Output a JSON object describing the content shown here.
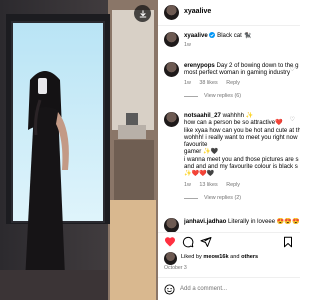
{
  "post": {
    "username": "xyaalive",
    "caption_user": "xyaalive",
    "caption_text": "Black cat 🐈‍⬛",
    "caption_time": "1w"
  },
  "comments": [
    {
      "username": "erenypops",
      "line1": "Day 2 of bowing down to the g",
      "line2": "most perfect woman in gaming industry",
      "time": "1w",
      "likes": "38 likes",
      "reply": "Reply",
      "view_replies": "View replies (6)"
    },
    {
      "username": "notsaahil_27",
      "line1_rest": "wahhhh ✨",
      "lines": [
        "how can a person be so attractive❤️",
        "like xyaa how can you be hot and cute at th",
        "wohhh! i really want to meet you right now",
        "favourite",
        "gamer ✨🖤",
        "i wanna meet you and those pictures are s",
        "and and and my favourite colour is black s",
        "✨❤️❤️🖤"
      ],
      "time": "1w",
      "likes": "13 likes",
      "reply": "Reply",
      "view_replies": "View replies (2)"
    },
    {
      "username": "janhavi.jadhao",
      "text": "Literally in loveee 😍😍😍"
    }
  ],
  "actions": {
    "liked_prefix": "Liked by",
    "liked_user": "meow16k",
    "liked_and": "and",
    "liked_others": "others",
    "date": "October 3"
  },
  "comment_box": {
    "placeholder": "Add a comment..."
  },
  "colors": {
    "like_red": "#ff3040",
    "verified_blue": "#0095f6",
    "muted_text": "#737373"
  }
}
